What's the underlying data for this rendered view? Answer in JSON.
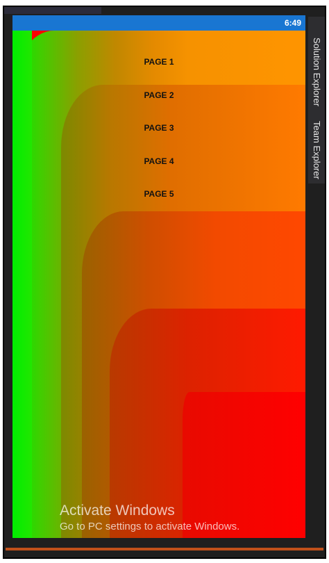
{
  "status_bar": {
    "time": "6:49",
    "color": "#1976d2"
  },
  "pages": [
    {
      "label": "PAGE 1"
    },
    {
      "label": "PAGE 2"
    },
    {
      "label": "PAGE 3"
    },
    {
      "label": "PAGE 4"
    },
    {
      "label": "PAGE 5"
    }
  ],
  "side_panel": {
    "tabs": [
      "Solution Explorer",
      "Team Explorer"
    ]
  },
  "watermark": {
    "title": "Activate Windows",
    "subtitle": "Go to PC settings to activate Windows."
  },
  "colors": {
    "gradient_start": "#00ee00",
    "gradient_mid": "#ff9400",
    "gradient_end": "#ff0000"
  }
}
